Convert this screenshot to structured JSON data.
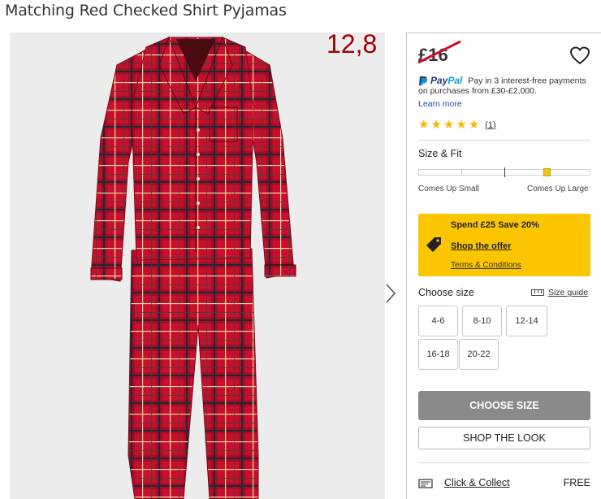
{
  "product": {
    "title": "Matching Red Checked Shirt Pyjamas"
  },
  "gallery": {
    "overlay_number": "12,8",
    "image_icon": "product-image",
    "next_icon": "chevron-right-icon"
  },
  "price": {
    "value": "£16",
    "struck_through": true,
    "wishlist_icon": "heart-icon"
  },
  "paypal": {
    "brand": "PayPal",
    "brand_part1": "Pay",
    "brand_part2": "Pal",
    "text": "Pay in 3 interest-free payments on purchases from £30-£2,000.",
    "learn_more": "Learn more"
  },
  "rating": {
    "stars": 5,
    "count": "(1)"
  },
  "size_fit": {
    "label": "Size & Fit",
    "left_label": "Comes Up Small",
    "right_label": "Comes Up Large",
    "level": 0.75
  },
  "offer": {
    "headline": "Spend £25 Save 20%",
    "link": "Shop the offer",
    "terms": "Terms & Conditions",
    "icon": "tag-icon",
    "color": "#fbc600"
  },
  "sizes": {
    "label": "Choose size",
    "guide": "Size guide",
    "options": [
      "4-6",
      "8-10",
      "12-14",
      "16-18",
      "20-22"
    ]
  },
  "actions": {
    "choose_size": "CHOOSE SIZE",
    "shop_the_look": "SHOP THE LOOK"
  },
  "delivery": {
    "method": "Click & Collect",
    "price": "FREE",
    "icon": "store-icon"
  },
  "colors": {
    "accent_red": "#c8102e",
    "overlay_text": "#a00000",
    "button_grey": "#8a8a8a"
  }
}
